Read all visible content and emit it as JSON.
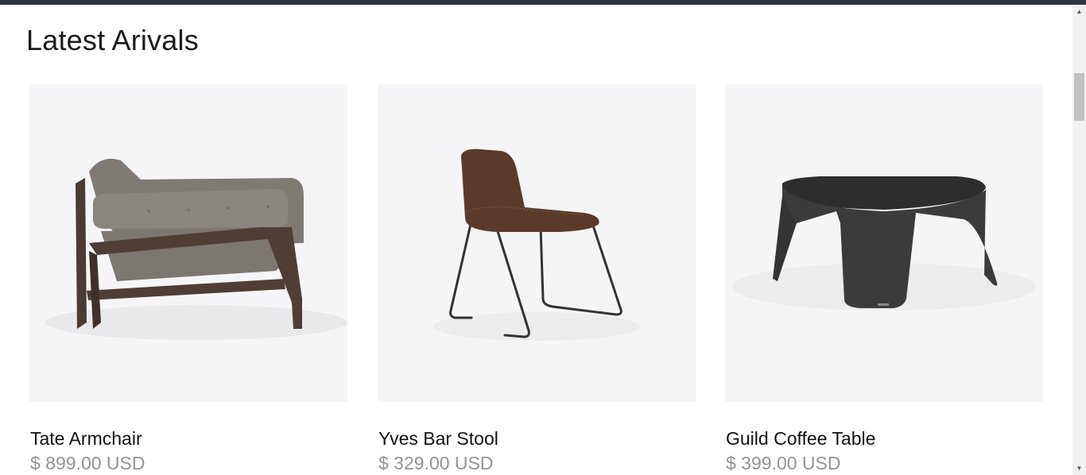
{
  "section": {
    "title": "Latest Arivals"
  },
  "products": [
    {
      "name": "Tate Armchair",
      "price": "$ 899.00 USD",
      "image_icon": "armchair-image"
    },
    {
      "name": "Yves Bar Stool",
      "price": "$ 329.00 USD",
      "image_icon": "bar-stool-image"
    },
    {
      "name": "Guild Coffee Table",
      "price": "$ 399.00 USD",
      "image_icon": "coffee-table-image"
    }
  ],
  "scrollbar": {
    "up_glyph": "▲",
    "down_glyph": "▼"
  }
}
